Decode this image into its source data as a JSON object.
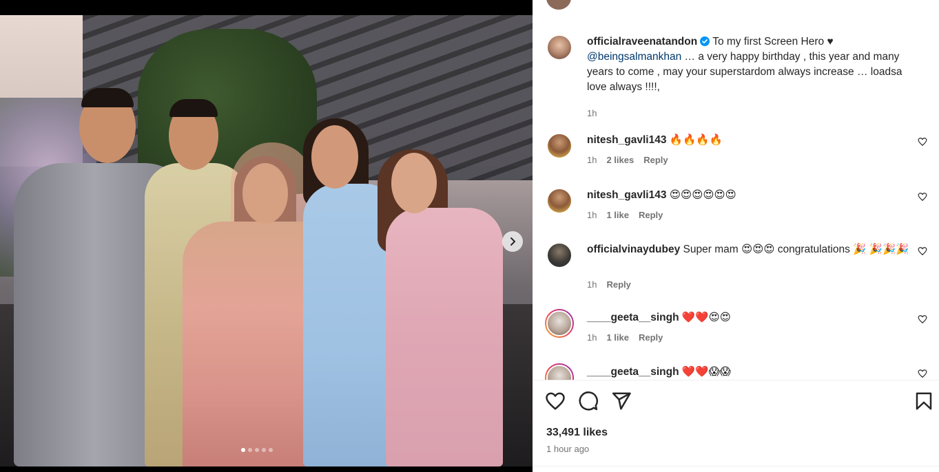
{
  "post": {
    "photo_alt": "",
    "carousel_dots": 5,
    "carousel_active": 1,
    "likes": "33,491 likes",
    "posted": "1 hour ago"
  },
  "caption": {
    "username": "officialraveenatandon",
    "text_before_mention": "To my first Screen Hero ♥",
    "mention": "@beingsalmankhan",
    "text_after_mention": " … a very happy birthday , this year and many years to come , may your superstardom always increase … loadsa love always !!!!,",
    "time": "1h"
  },
  "comments": [
    {
      "username": "nitesh_gavli143",
      "text": "🔥🔥🔥🔥",
      "time": "1h",
      "likes": "2 likes",
      "reply": "Reply"
    },
    {
      "username": "nitesh_gavli143",
      "text": "😍😍😍😍😍😍",
      "time": "1h",
      "likes": "1 like",
      "reply": "Reply"
    },
    {
      "username": "officialvinaydubey",
      "text": "Super mam 😍😍😍 congratulations 🎉 🎉🎉🎉",
      "time": "1h",
      "likes": "",
      "reply": "Reply"
    },
    {
      "username": "____geeta__singh",
      "text": "❤️❤️😍😍",
      "time": "1h",
      "likes": "1 like",
      "reply": "Reply"
    },
    {
      "username": "____geeta__singh",
      "text": "❤️❤️😱😱",
      "time": "",
      "likes": "",
      "reply": ""
    }
  ],
  "colors": {
    "text": "#262626",
    "muted": "#737373",
    "link": "#00376b",
    "verified": "#0095f6"
  },
  "icons": {
    "like": "heart-icon",
    "comment": "comment-icon",
    "share": "paper-plane-icon",
    "save": "bookmark-icon",
    "next": "chevron-right-icon"
  }
}
